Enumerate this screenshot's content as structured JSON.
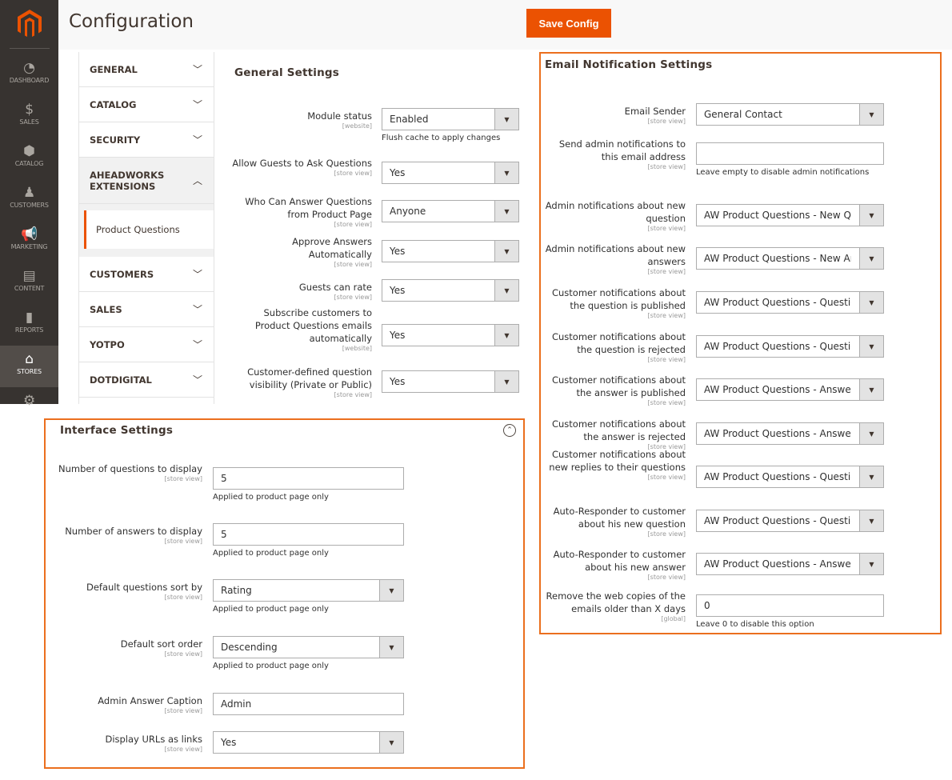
{
  "header": {
    "title": "Configuration",
    "save_label": "Save Config"
  },
  "colors": {
    "accent": "#eb5202",
    "highlight_border": "#eb6f1e",
    "sidebar": "#373330"
  },
  "nav": [
    {
      "label": "DASHBOARD",
      "icon": "dashboard-icon"
    },
    {
      "label": "SALES",
      "icon": "dollar-icon"
    },
    {
      "label": "CATALOG",
      "icon": "box-icon"
    },
    {
      "label": "CUSTOMERS",
      "icon": "person-icon"
    },
    {
      "label": "MARKETING",
      "icon": "megaphone-icon"
    },
    {
      "label": "CONTENT",
      "icon": "layout-icon"
    },
    {
      "label": "REPORTS",
      "icon": "bar-chart-icon"
    },
    {
      "label": "STORES",
      "icon": "store-icon",
      "active": true
    },
    {
      "label": "",
      "icon": "gear-icon"
    }
  ],
  "tabs": [
    {
      "label": "GENERAL"
    },
    {
      "label": "CATALOG"
    },
    {
      "label": "SECURITY"
    },
    {
      "label": "AHEADWORKS EXTENSIONS",
      "open": true,
      "children": [
        "Product Questions"
      ]
    },
    {
      "label": "CUSTOMERS"
    },
    {
      "label": "SALES"
    },
    {
      "label": "YOTPO"
    },
    {
      "label": "DOTDIGITAL"
    }
  ],
  "general": {
    "title": "General Settings",
    "rows": [
      {
        "label": "Module status",
        "scope": "[website]",
        "type": "select",
        "value": "Enabled",
        "note": "Flush cache to apply changes"
      },
      {
        "label": "Allow Guests to Ask Questions",
        "scope": "[store view]",
        "type": "select",
        "value": "Yes"
      },
      {
        "label": "Who Can Answer Questions from Product Page",
        "scope": "[store view]",
        "type": "select",
        "value": "Anyone"
      },
      {
        "label": "Approve Answers Automatically",
        "scope": "[store view]",
        "type": "select",
        "value": "Yes"
      },
      {
        "label": "Guests can rate",
        "scope": "[store view]",
        "type": "select",
        "value": "Yes"
      },
      {
        "label": "Subscribe customers to Product Questions emails automatically",
        "scope": "[website]",
        "type": "select",
        "value": "Yes"
      },
      {
        "label": "Customer-defined question visibility (Private or Public)",
        "scope": "[store view]",
        "type": "select",
        "value": "Yes"
      }
    ]
  },
  "email": {
    "title": "Email Notification Settings",
    "rows": [
      {
        "label": "Email Sender",
        "scope": "[store view]",
        "type": "select",
        "value": "General Contact"
      },
      {
        "label": "Send admin notifications to this email address",
        "scope": "[store view]",
        "type": "text",
        "value": "",
        "note": "Leave empty to disable admin notifications"
      },
      {
        "label": "Admin notifications about new question",
        "scope": "[store view]",
        "type": "select",
        "value": "AW Product Questions - New Question"
      },
      {
        "label": "Admin notifications about new answers",
        "scope": "[store view]",
        "type": "select",
        "value": "AW Product Questions - New Answer"
      },
      {
        "label": "Customer notifications about the question is published",
        "scope": "[store view]",
        "type": "select",
        "value": "AW Product Questions - Question Published"
      },
      {
        "label": "Customer notifications about the question is rejected",
        "scope": "[store view]",
        "type": "select",
        "value": "AW Product Questions - Question Rejected"
      },
      {
        "label": "Customer notifications about the answer is published",
        "scope": "[store view]",
        "type": "select",
        "value": "AW Product Questions - Answer Published"
      },
      {
        "label": "Customer notifications about the answer is rejected",
        "scope": "[store view]",
        "type": "select",
        "value": "AW Product Questions - Answer Rejected"
      },
      {
        "label": "Customer notifications about new replies to their questions",
        "scope": "[store view]",
        "type": "select",
        "value": "AW Product Questions - Question Answered"
      },
      {
        "label": "Auto-Responder to customer about his new question",
        "scope": "[store view]",
        "type": "select",
        "value": "AW Product Questions - Question Auto-Responder"
      },
      {
        "label": "Auto-Responder to customer about his new answer",
        "scope": "[store view]",
        "type": "select",
        "value": "AW Product Questions - Answer Auto-Responder"
      },
      {
        "label": "Remove the web copies of the emails older than X days",
        "scope": "[global]",
        "type": "text",
        "value": "0",
        "note": "Leave 0 to disable this option"
      }
    ]
  },
  "interface": {
    "title": "Interface Settings",
    "rows": [
      {
        "label": "Number of questions to display",
        "scope": "[store view]",
        "type": "text",
        "value": "5",
        "note": "Applied to product page only"
      },
      {
        "label": "Number of answers to display",
        "scope": "[store view]",
        "type": "text",
        "value": "5",
        "note": "Applied to product page only"
      },
      {
        "label": "Default questions sort by",
        "scope": "[store view]",
        "type": "select",
        "value": "Rating",
        "note": "Applied to product page only"
      },
      {
        "label": "Default sort order",
        "scope": "[store view]",
        "type": "select",
        "value": "Descending",
        "note": "Applied to product page only"
      },
      {
        "label": "Admin Answer Caption",
        "scope": "[store view]",
        "type": "text",
        "value": "Admin"
      },
      {
        "label": "Display URLs as links",
        "scope": "[store view]",
        "type": "select",
        "value": "Yes"
      }
    ]
  }
}
